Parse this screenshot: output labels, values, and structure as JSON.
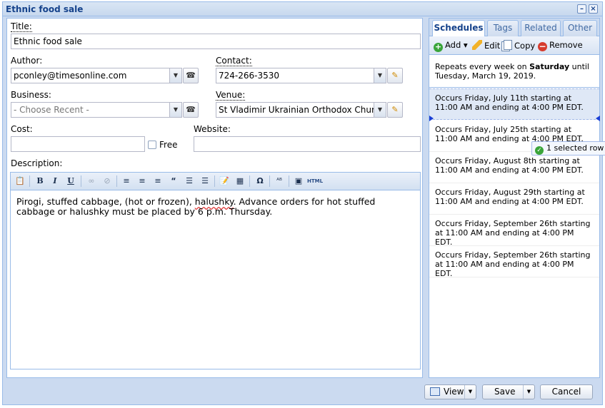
{
  "window": {
    "title": "Ethnic food sale",
    "minimize": "–",
    "close": "×"
  },
  "form": {
    "title_label": "Title:",
    "title_value": "Ethnic food sale",
    "author_label": "Author:",
    "author_value": "pconley@timesonline.com",
    "contact_label": "Contact:",
    "contact_value": "724-266-3530",
    "business_label": "Business:",
    "business_placeholder": "- Choose Recent -",
    "venue_label": "Venue:",
    "venue_value": "St Vladimir Ukrainian Orthodox Church",
    "cost_label": "Cost:",
    "cost_value": "",
    "free_label": "Free",
    "website_label": "Website:",
    "website_value": "",
    "description_label": "Description:",
    "description_before": "Pirogi, stuffed cabbage, (hot or frozen), ",
    "description_misspelled": "halushky",
    "description_after": ". Advance orders for hot stuffed cabbage or halushky must be placed by 6 p.m. Thursday."
  },
  "editor_toolbar": {
    "bold": "B",
    "italic": "I",
    "underline": "U",
    "quote": "“",
    "special_char": "Ω",
    "html": "HTML"
  },
  "sidebar": {
    "tabs": [
      {
        "label": "Schedules"
      },
      {
        "label": "Tags"
      },
      {
        "label": "Related"
      },
      {
        "label": "Other"
      }
    ],
    "toolbar": {
      "add": "Add",
      "edit": "Edit",
      "copy": "Copy",
      "remove": "Remove"
    },
    "repeat_before": "Repeats every week on ",
    "repeat_day": "Saturday",
    "repeat_after": " until Tuesday, March 19, 2019.",
    "occurrences": [
      "Occurs Friday, July 11th starting at 11:00 AM and ending at 4:00 PM EDT.",
      "Occurs Friday, July 25th starting at 11:00 AM and ending at 4:00 PM EDT.",
      "Occurs Friday, August 8th starting at 11:00 AM and ending at 4:00 PM EDT.",
      "Occurs Friday, August 29th starting at 11:00 AM and ending at 4:00 PM EDT.",
      "Occurs Friday, September 26th starting at 11:00 AM and ending at 4:00 PM EDT.",
      "Occurs Friday, September 26th starting at 11:00 AM and ending at 4:00 PM EDT."
    ],
    "tooltip": "1 selected row"
  },
  "footer": {
    "view": "View",
    "save": "Save",
    "cancel": "Cancel"
  },
  "colors": {
    "accent": "#15428b",
    "border": "#99bbe8",
    "panel_bg": "#cbdaf0",
    "add_green": "#3aa53a",
    "remove_red": "#d63c2e"
  }
}
